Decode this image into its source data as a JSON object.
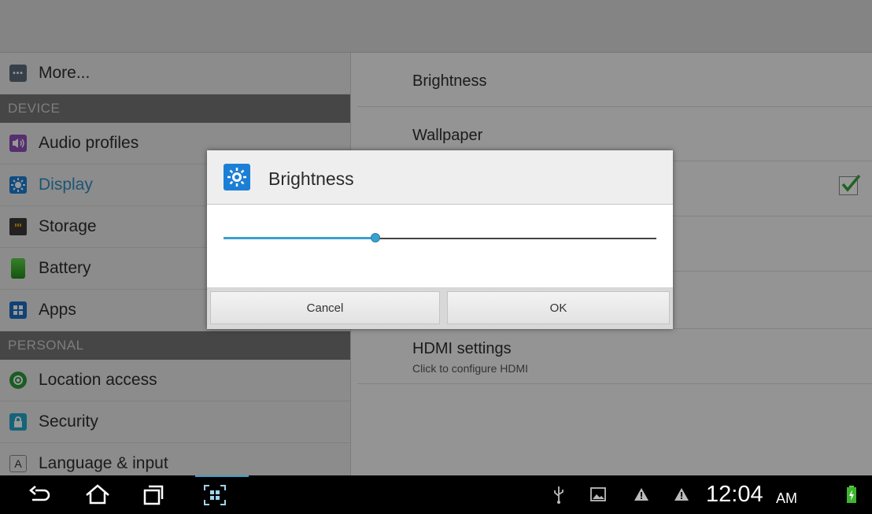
{
  "settings": {
    "left_items": [
      {
        "label": "More...",
        "icon": "more-icon"
      },
      {
        "label": "Audio profiles",
        "icon": "audio-profiles-icon"
      },
      {
        "label": "Display",
        "icon": "display-icon",
        "selected": true
      },
      {
        "label": "Storage",
        "icon": "storage-icon"
      },
      {
        "label": "Battery",
        "icon": "battery-icon"
      },
      {
        "label": "Apps",
        "icon": "apps-icon"
      },
      {
        "label": "Location access",
        "icon": "location-icon"
      },
      {
        "label": "Security",
        "icon": "security-icon"
      },
      {
        "label": "Language & input",
        "icon": "language-icon"
      }
    ],
    "headers": {
      "device": "DEVICE",
      "personal": "PERSONAL"
    },
    "right_items": [
      {
        "title": "Brightness"
      },
      {
        "title": "Wallpaper"
      },
      {
        "title": "HDMI settings",
        "subtitle": "Click to configure HDMI"
      }
    ]
  },
  "dialog": {
    "title": "Brightness",
    "slider_value": 0.35,
    "cancel_label": "Cancel",
    "ok_label": "OK"
  },
  "status_bar": {
    "time": "12:04",
    "ampm": "AM"
  },
  "colors": {
    "accent": "#3ba0cf",
    "selected_text": "#2f8ec3"
  }
}
